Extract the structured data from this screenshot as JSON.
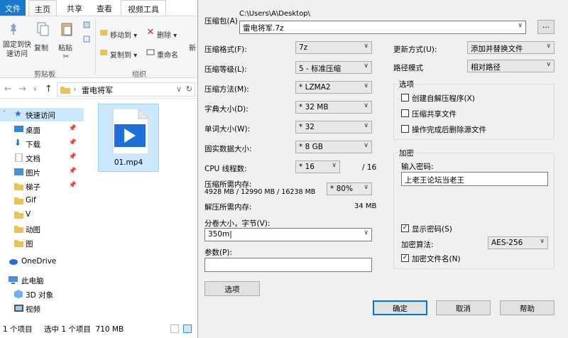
{
  "explorer": {
    "tabs": [
      "文件",
      "主页",
      "共享",
      "查看",
      "视频工具"
    ],
    "ribbon": {
      "pin_label": "固定到快\n速访问",
      "copy_label": "复制",
      "paste_label": "粘贴",
      "move_to": "移动到",
      "copy_to": "复制到",
      "delete": "删除",
      "rename": "重命名",
      "new_partial": "新",
      "clipboard_group": "剪贴板",
      "organize_group": "组织"
    },
    "address": "雷电将军",
    "nav": [
      {
        "label": "快速访问",
        "pinned": false
      },
      {
        "label": "桌面",
        "pinned": true
      },
      {
        "label": "下载",
        "pinned": true
      },
      {
        "label": "文档",
        "pinned": true
      },
      {
        "label": "图片",
        "pinned": true
      },
      {
        "label": "梯子",
        "pinned": true
      },
      {
        "label": "Gif",
        "pinned": false
      },
      {
        "label": "V",
        "pinned": false
      },
      {
        "label": "动图",
        "pinned": false
      },
      {
        "label": "图",
        "pinned": false
      },
      {
        "label": "OneDrive",
        "pinned": false
      },
      {
        "label": "此电脑",
        "pinned": false
      },
      {
        "label": "3D 对象",
        "pinned": false
      },
      {
        "label": "视频",
        "pinned": false
      }
    ],
    "file_name": "01.mp4",
    "status": {
      "count": "1 个项目",
      "selected": "选中 1 个项目  710 MB"
    }
  },
  "dialog": {
    "archive_label": "压缩包(A)",
    "archive_path": "C:\\Users\\A\\Desktop\\",
    "archive_name": "雷电将军.7z",
    "browse": "...",
    "format_label": "压缩格式(F):",
    "format_value": "7z",
    "level_label": "压缩等级(L):",
    "level_value": "5 - 标准压缩",
    "method_label": "压缩方法(M):",
    "method_value": "* LZMA2",
    "dict_label": "字典大小(D):",
    "dict_value": "* 32 MB",
    "word_label": "单词大小(W):",
    "word_value": "* 32",
    "solid_label": "固实数据大小:",
    "solid_value": "* 8 GB",
    "threads_label": "CPU 线程数:",
    "threads_value": "* 16",
    "threads_max": "/ 16",
    "mem_comp_label": "压缩所需内存:",
    "mem_comp_value": "4928 MB / 12990 MB / 16238 MB",
    "mem_pct": "* 80%",
    "mem_decomp_label": "解压所需内存:",
    "mem_decomp_value": "34 MB",
    "split_label": "分卷大小，字节(V):",
    "split_value": "350m",
    "params_label": "参数(P):",
    "params_value": "",
    "options_btn": "选项",
    "update_label": "更新方式(U):",
    "update_value": "添加并替换文件",
    "path_label": "路径模式",
    "path_value": "相对路径",
    "options_group": "选项",
    "opt_sfx": "创建自解压程序(X)",
    "opt_shared": "压缩共享文件",
    "opt_delete": "操作完成后删除源文件",
    "enc_group": "加密",
    "enc_pwd_label": "输入密码:",
    "enc_pwd_value": "上老王论坛当老王",
    "show_pwd": "显示密码(S)",
    "enc_method_label": "加密算法:",
    "enc_method_value": "AES-256",
    "enc_names": "加密文件名(N)",
    "ok": "确定",
    "cancel": "取消",
    "help": "帮助"
  }
}
